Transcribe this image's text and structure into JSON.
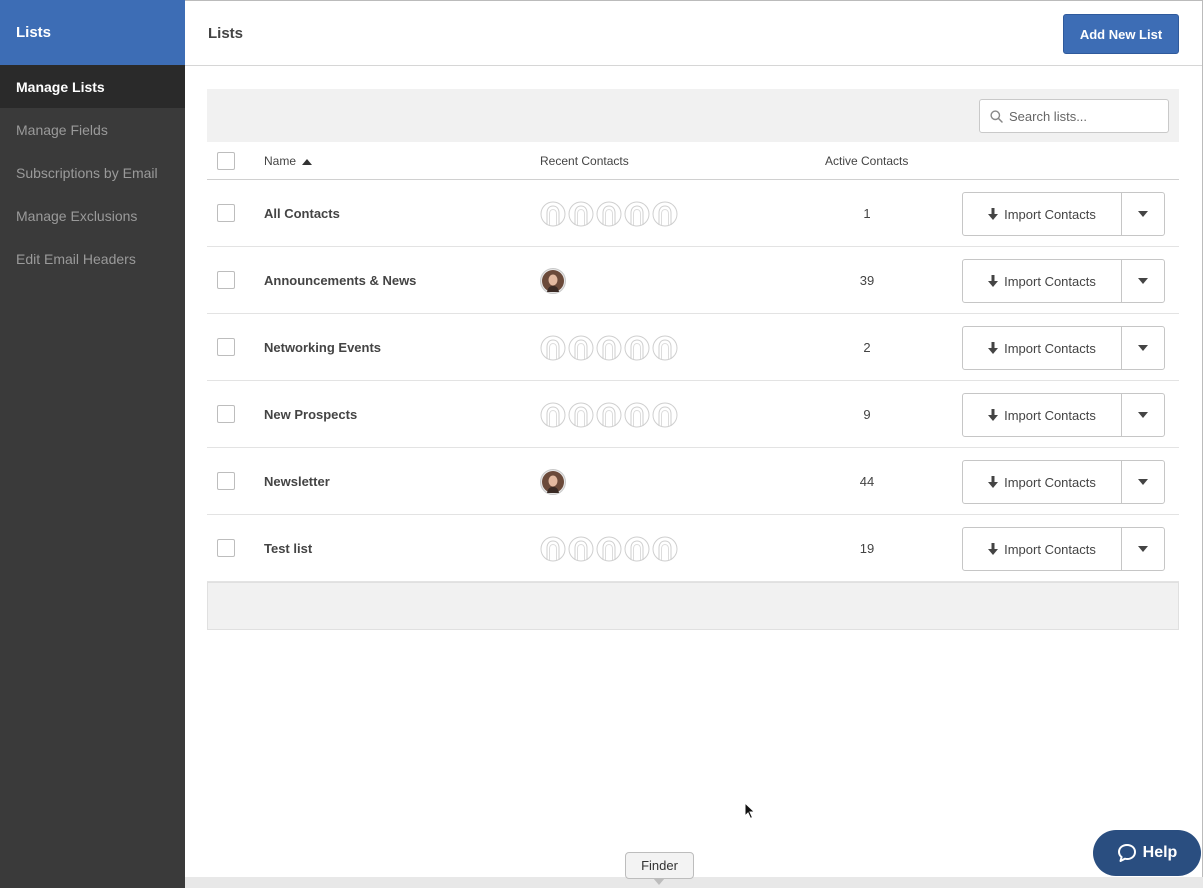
{
  "sidebar": {
    "header": "Lists",
    "items": [
      {
        "label": "Manage Lists",
        "active": true
      },
      {
        "label": "Manage Fields",
        "active": false
      },
      {
        "label": "Subscriptions by Email",
        "active": false
      },
      {
        "label": "Manage Exclusions",
        "active": false
      },
      {
        "label": "Edit Email Headers",
        "active": false
      }
    ]
  },
  "header": {
    "title": "Lists",
    "add_button": "Add New List"
  },
  "search": {
    "placeholder": "Search lists..."
  },
  "table": {
    "columns": {
      "name": "Name",
      "recent": "Recent Contacts",
      "active": "Active Contacts"
    },
    "sort": "name-ascending",
    "rows": [
      {
        "name": "All Contacts",
        "recent": "placeholders",
        "count": "1",
        "action": "Import Contacts"
      },
      {
        "name": "Announcements & News",
        "recent": "photo",
        "count": "39",
        "action": "Import Contacts"
      },
      {
        "name": "Networking Events",
        "recent": "placeholders",
        "count": "2",
        "action": "Import Contacts"
      },
      {
        "name": "New Prospects",
        "recent": "placeholders",
        "count": "9",
        "action": "Import Contacts"
      },
      {
        "name": "Newsletter",
        "recent": "photo",
        "count": "44",
        "action": "Import Contacts"
      },
      {
        "name": "Test list",
        "recent": "placeholders",
        "count": "19",
        "action": "Import Contacts"
      }
    ]
  },
  "help": {
    "label": "Help"
  },
  "tooltip": {
    "text": "Finder"
  },
  "colors": {
    "brand": "#3d6db5",
    "sidebar_bg": "#3a3a3a",
    "help_bg": "#2a4e80"
  }
}
